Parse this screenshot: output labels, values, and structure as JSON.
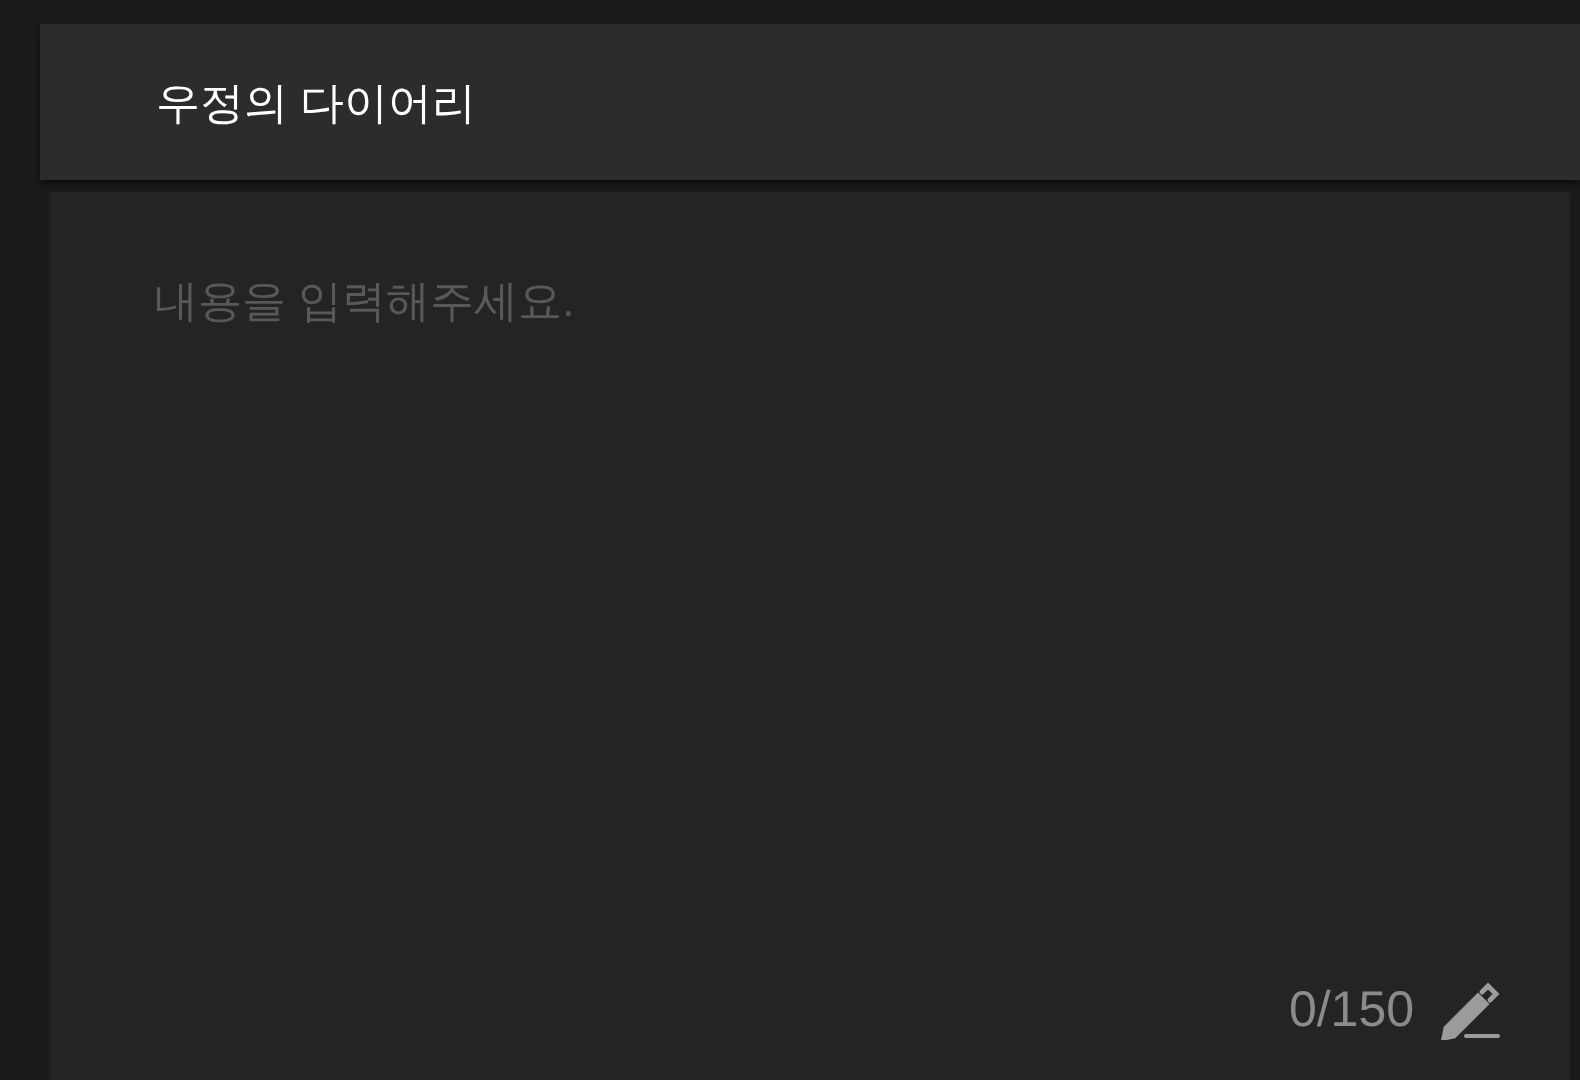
{
  "header": {
    "title": "우정의 다이어리"
  },
  "editor": {
    "placeholder": "내용을 입력해주세요."
  },
  "counter": "0/150"
}
